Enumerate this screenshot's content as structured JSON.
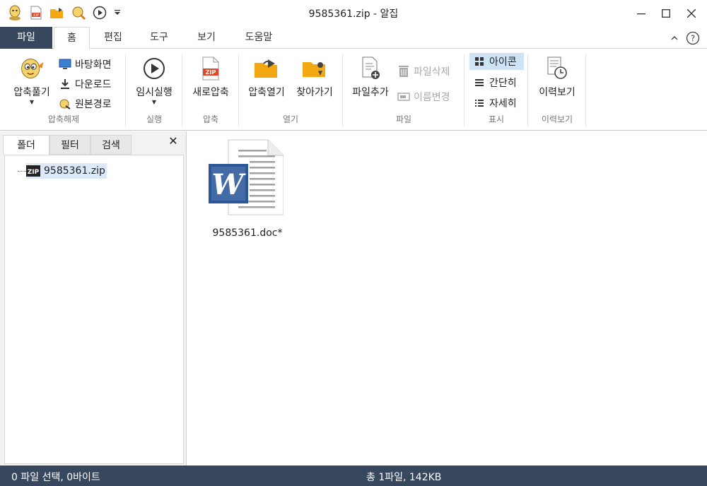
{
  "window": {
    "title": "9585361.zip - 알집",
    "controls": [
      "minimize",
      "maximize",
      "close"
    ]
  },
  "quick_access": [
    "app-logo-icon",
    "new-zip-icon",
    "open-folder-icon",
    "extract-icon",
    "run-icon",
    "customize-dropdown-icon"
  ],
  "tabs": {
    "file": "파일",
    "items": [
      {
        "label": "홈",
        "active": true
      },
      {
        "label": "편집",
        "active": false
      },
      {
        "label": "도구",
        "active": false
      },
      {
        "label": "보기",
        "active": false
      },
      {
        "label": "도움말",
        "active": false
      }
    ]
  },
  "ribbon": {
    "extract_group": {
      "label": "압축해제",
      "extract_button": "압축풀기",
      "desktop_button": "바탕화면",
      "download_button": "다운로드",
      "original_path_button": "원본경로"
    },
    "run_group": {
      "label": "실행",
      "temp_run_button": "임시실행"
    },
    "compress_group": {
      "label": "압축",
      "new_compress_button": "새로압축"
    },
    "open_group": {
      "label": "열기",
      "open_zip_button": "압축열기",
      "browse_button": "찾아가기"
    },
    "file_group": {
      "label": "파일",
      "add_file_button": "파일추가",
      "delete_file_button": "파일삭제",
      "rename_button": "이름변경"
    },
    "view_group": {
      "label": "표시",
      "icon_view": "아이콘",
      "simple_view": "간단히",
      "detail_view": "자세히"
    },
    "history_group": {
      "label": "이력보기",
      "history_button": "이력보기"
    }
  },
  "left_panel": {
    "tabs": [
      "폴더",
      "필터",
      "검색"
    ],
    "active_tab": "폴더",
    "tree": {
      "root": "9585361.zip"
    }
  },
  "main": {
    "files": [
      {
        "name": "9585361.doc*",
        "type": "word-document-icon"
      }
    ]
  },
  "status": {
    "selection": "0 파일 선택,  0바이트",
    "total": "총 1파일,  142KB"
  },
  "colors": {
    "accent_dark": "#37475e",
    "selected_bg": "#cfe3f7",
    "word_blue": "#2b579a",
    "folder_orange": "#f3a712",
    "zip_red": "#e04a2a"
  }
}
